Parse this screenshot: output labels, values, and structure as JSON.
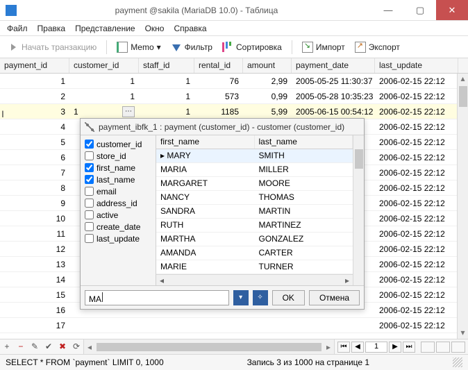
{
  "window": {
    "title": "payment @sakila (MariaDB 10.0) - Таблица"
  },
  "menu": {
    "file": "Файл",
    "edit": "Правка",
    "view": "Представление",
    "window": "Окно",
    "help": "Справка"
  },
  "toolbar": {
    "start_tx": "Начать транзакцию",
    "memo": "Memo",
    "filter": "Фильтр",
    "sort": "Сортировка",
    "import": "Импорт",
    "export": "Экспорт"
  },
  "columns": {
    "payment_id": "payment_id",
    "customer_id": "customer_id",
    "staff_id": "staff_id",
    "rental_id": "rental_id",
    "amount": "amount",
    "payment_date": "payment_date",
    "last_update": "last_update"
  },
  "rows": [
    {
      "pid": "1",
      "cid": "1",
      "sid": "1",
      "rid": "76",
      "amt": "2,99",
      "pd": "2005-05-25 11:30:37",
      "lu": "2006-02-15 22:12"
    },
    {
      "pid": "2",
      "cid": "1",
      "sid": "1",
      "rid": "573",
      "amt": "0,99",
      "pd": "2005-05-28 10:35:23",
      "lu": "2006-02-15 22:12"
    },
    {
      "pid": "3",
      "cid": "1",
      "sid": "1",
      "rid": "1185",
      "amt": "5,99",
      "pd": "2005-06-15 00:54:12",
      "lu": "2006-02-15 22:12"
    },
    {
      "pid": "4",
      "cid": "",
      "sid": "",
      "rid": "",
      "amt": "",
      "pd": "",
      "lu": "2006-02-15 22:12"
    },
    {
      "pid": "5",
      "cid": "",
      "sid": "",
      "rid": "",
      "amt": "",
      "pd": "",
      "lu": "2006-02-15 22:12"
    },
    {
      "pid": "6",
      "cid": "",
      "sid": "",
      "rid": "",
      "amt": "",
      "pd": "",
      "lu": "2006-02-15 22:12"
    },
    {
      "pid": "7",
      "cid": "",
      "sid": "",
      "rid": "",
      "amt": "",
      "pd": "",
      "lu": "2006-02-15 22:12"
    },
    {
      "pid": "8",
      "cid": "",
      "sid": "",
      "rid": "",
      "amt": "",
      "pd": "",
      "lu": "2006-02-15 22:12"
    },
    {
      "pid": "9",
      "cid": "",
      "sid": "",
      "rid": "",
      "amt": "",
      "pd": "",
      "lu": "2006-02-15 22:12"
    },
    {
      "pid": "10",
      "cid": "",
      "sid": "",
      "rid": "",
      "amt": "",
      "pd": "",
      "lu": "2006-02-15 22:12"
    },
    {
      "pid": "11",
      "cid": "",
      "sid": "",
      "rid": "",
      "amt": "",
      "pd": "",
      "lu": "2006-02-15 22:12"
    },
    {
      "pid": "12",
      "cid": "",
      "sid": "",
      "rid": "",
      "amt": "",
      "pd": "",
      "lu": "2006-02-15 22:12"
    },
    {
      "pid": "13",
      "cid": "",
      "sid": "",
      "rid": "",
      "amt": "",
      "pd": "",
      "lu": "2006-02-15 22:12"
    },
    {
      "pid": "14",
      "cid": "",
      "sid": "",
      "rid": "",
      "amt": "",
      "pd": "",
      "lu": "2006-02-15 22:12"
    },
    {
      "pid": "15",
      "cid": "",
      "sid": "",
      "rid": "",
      "amt": "",
      "pd": "",
      "lu": "2006-02-15 22:12"
    },
    {
      "pid": "16",
      "cid": "",
      "sid": "",
      "rid": "",
      "amt": "",
      "pd": "",
      "lu": "2006-02-15 22:12"
    },
    {
      "pid": "17",
      "cid": "",
      "sid": "",
      "rid": "",
      "amt": "",
      "pd": "",
      "lu": "2006-02-15 22:12"
    }
  ],
  "selected_row": 2,
  "cell_edit_value": "1",
  "popup": {
    "title": "payment_ibfk_1 : payment (customer_id) - customer (customer_id)",
    "checks": [
      {
        "label": "customer_id",
        "checked": true
      },
      {
        "label": "store_id",
        "checked": false
      },
      {
        "label": "first_name",
        "checked": true
      },
      {
        "label": "last_name",
        "checked": true
      },
      {
        "label": "email",
        "checked": false
      },
      {
        "label": "address_id",
        "checked": false
      },
      {
        "label": "active",
        "checked": false
      },
      {
        "label": "create_date",
        "checked": false
      },
      {
        "label": "last_update",
        "checked": false
      }
    ],
    "fk_columns": {
      "first": "first_name",
      "last": "last_name"
    },
    "fk_rows": [
      {
        "first": "MARY",
        "last": "SMITH"
      },
      {
        "first": "MARIA",
        "last": "MILLER"
      },
      {
        "first": "MARGARET",
        "last": "MOORE"
      },
      {
        "first": "NANCY",
        "last": "THOMAS"
      },
      {
        "first": "SANDRA",
        "last": "MARTIN"
      },
      {
        "first": "RUTH",
        "last": "MARTINEZ"
      },
      {
        "first": "MARTHA",
        "last": "GONZALEZ"
      },
      {
        "first": "AMANDA",
        "last": "CARTER"
      },
      {
        "first": "MARIE",
        "last": "TURNER"
      }
    ],
    "fk_selected": 0,
    "filter_value": "MA",
    "ok": "OK",
    "cancel": "Отмена"
  },
  "nav": {
    "page": "1"
  },
  "status": {
    "query": "SELECT * FROM `payment` LIMIT 0, 1000",
    "position": "Запись 3 из 1000 на странице 1"
  }
}
